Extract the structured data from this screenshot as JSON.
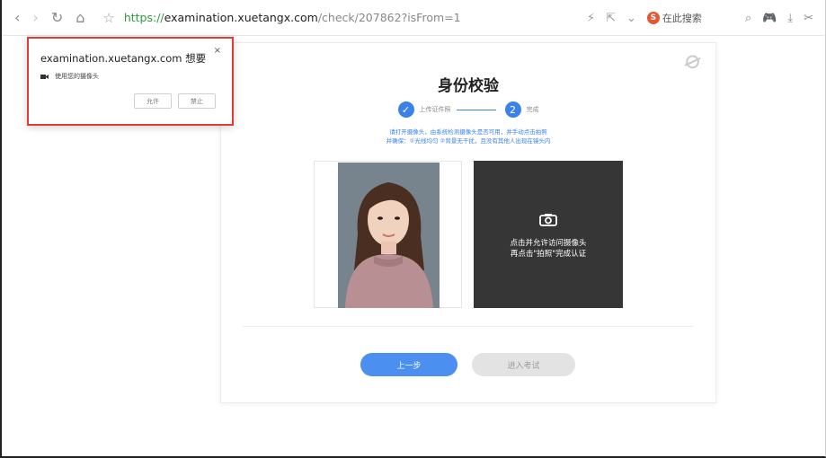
{
  "browser": {
    "url_scheme": "https://",
    "url_host": "examination.xuetangx.com",
    "url_path": "/check/207862?isFrom=1",
    "search_label": "在此搜索",
    "sogou_logo": "S"
  },
  "permission_popup": {
    "title": "examination.xuetangx.com 想要",
    "close": "×",
    "permission": "使用您的摄像头",
    "allow_label": "允许",
    "block_label": "禁止",
    "highlight_color": "#e03a3a"
  },
  "card": {
    "title": "身份校验",
    "steps": [
      {
        "marker": "✓",
        "label": "上传证件照"
      },
      {
        "marker": "2",
        "label": "完成"
      }
    ],
    "note_line1": "请打开摄像头，由系统检测摄像头是否可用，并手动点击拍照",
    "note_line2": "并确保：①光线均匀 ②背景无干扰，且没有其他人出现在镜头内",
    "camera_text_line1": "点击并允许访问摄像头",
    "camera_text_line2": "再点击\"拍照\"完成认证",
    "prev_button": "上一步",
    "enter_exam_button": "进入考试",
    "accent_color": "#3b82e8"
  }
}
